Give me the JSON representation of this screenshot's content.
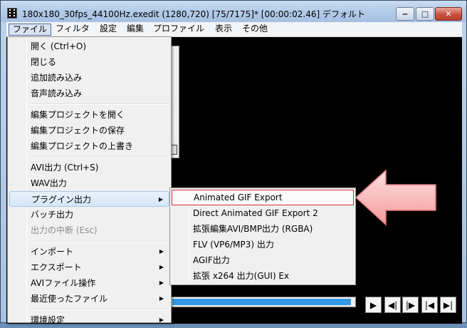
{
  "window": {
    "title": "180x180_30fps_44100Hz.exedit (1280,720)  [75/7175]* [00:00:02.46]  デフォルト",
    "buttons": {
      "minimize": "‒",
      "maximize": "□",
      "close": "✕"
    }
  },
  "menubar": [
    "ファイル",
    "フィルタ",
    "設定",
    "編集",
    "プロファイル",
    "表示",
    "その他"
  ],
  "file_menu": {
    "items": [
      {
        "label": "開く (Ctrl+O)"
      },
      {
        "label": "閉じる"
      },
      {
        "label": "追加読み込み"
      },
      {
        "label": "音声読み込み"
      },
      {
        "label": "編集プロジェクトを開く"
      },
      {
        "label": "編集プロジェクトの保存"
      },
      {
        "label": "編集プロジェクトの上書き"
      },
      {
        "label": "AVI出力 (Ctrl+S)"
      },
      {
        "label": "WAV出力"
      },
      {
        "label": "プラグイン出力"
      },
      {
        "label": "バッチ出力"
      },
      {
        "label": "出力の中断 (Esc)"
      },
      {
        "label": "インポート"
      },
      {
        "label": "エクスポート"
      },
      {
        "label": "AVIファイル操作"
      },
      {
        "label": "最近使ったファイル"
      },
      {
        "label": "環境設定"
      }
    ],
    "submenu_arrow": "▶"
  },
  "plugin_submenu": {
    "items": [
      {
        "label": "Animated GIF Export"
      },
      {
        "label": "Direct Animated GIF Export 2"
      },
      {
        "label": "拡張編集AVI/BMP出力 (RGBA)"
      },
      {
        "label": "FLV (VP6/MP3) 出力"
      },
      {
        "label": "AGIF出力"
      },
      {
        "label": "拡張 x264 出力(GUI) Ex"
      }
    ]
  },
  "playback_controls": [
    "▶",
    "◀|",
    "|▶",
    "|◀",
    "▶|"
  ],
  "seek_progress": 0.98,
  "colors": {
    "highlight_box": "#cc3333",
    "pointer_arrow": "#f7a6a6",
    "seek_fill": "#3399e6"
  }
}
